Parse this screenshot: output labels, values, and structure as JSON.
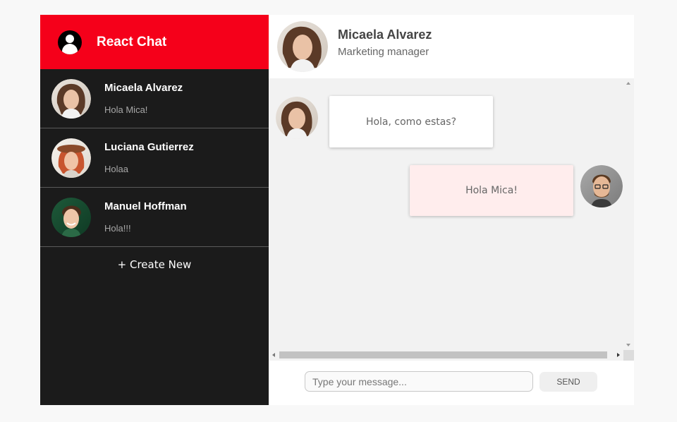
{
  "app": {
    "title": "React Chat",
    "logo_icon": "user-circle-icon"
  },
  "colors": {
    "brand": "#f5001a",
    "sidebar_bg": "#1b1b1b",
    "chat_bg": "#f2f2f2",
    "outgoing_bubble": "#ffeded"
  },
  "conversations": [
    {
      "name": "Micaela Alvarez",
      "preview": "Hola Mica!"
    },
    {
      "name": "Luciana Gutierrez",
      "preview": "Holaa"
    },
    {
      "name": "Manuel Hoffman",
      "preview": "Hola!!!"
    }
  ],
  "create_new_label": "+ Create New",
  "chat": {
    "contact_name": "Micaela Alvarez",
    "contact_role": "Marketing manager",
    "messages": [
      {
        "direction": "incoming",
        "text": "Hola, como estas?"
      },
      {
        "direction": "outgoing",
        "text": "Hola Mica!"
      }
    ]
  },
  "composer": {
    "placeholder": "Type your message...",
    "value": "",
    "send_label": "SEND"
  }
}
